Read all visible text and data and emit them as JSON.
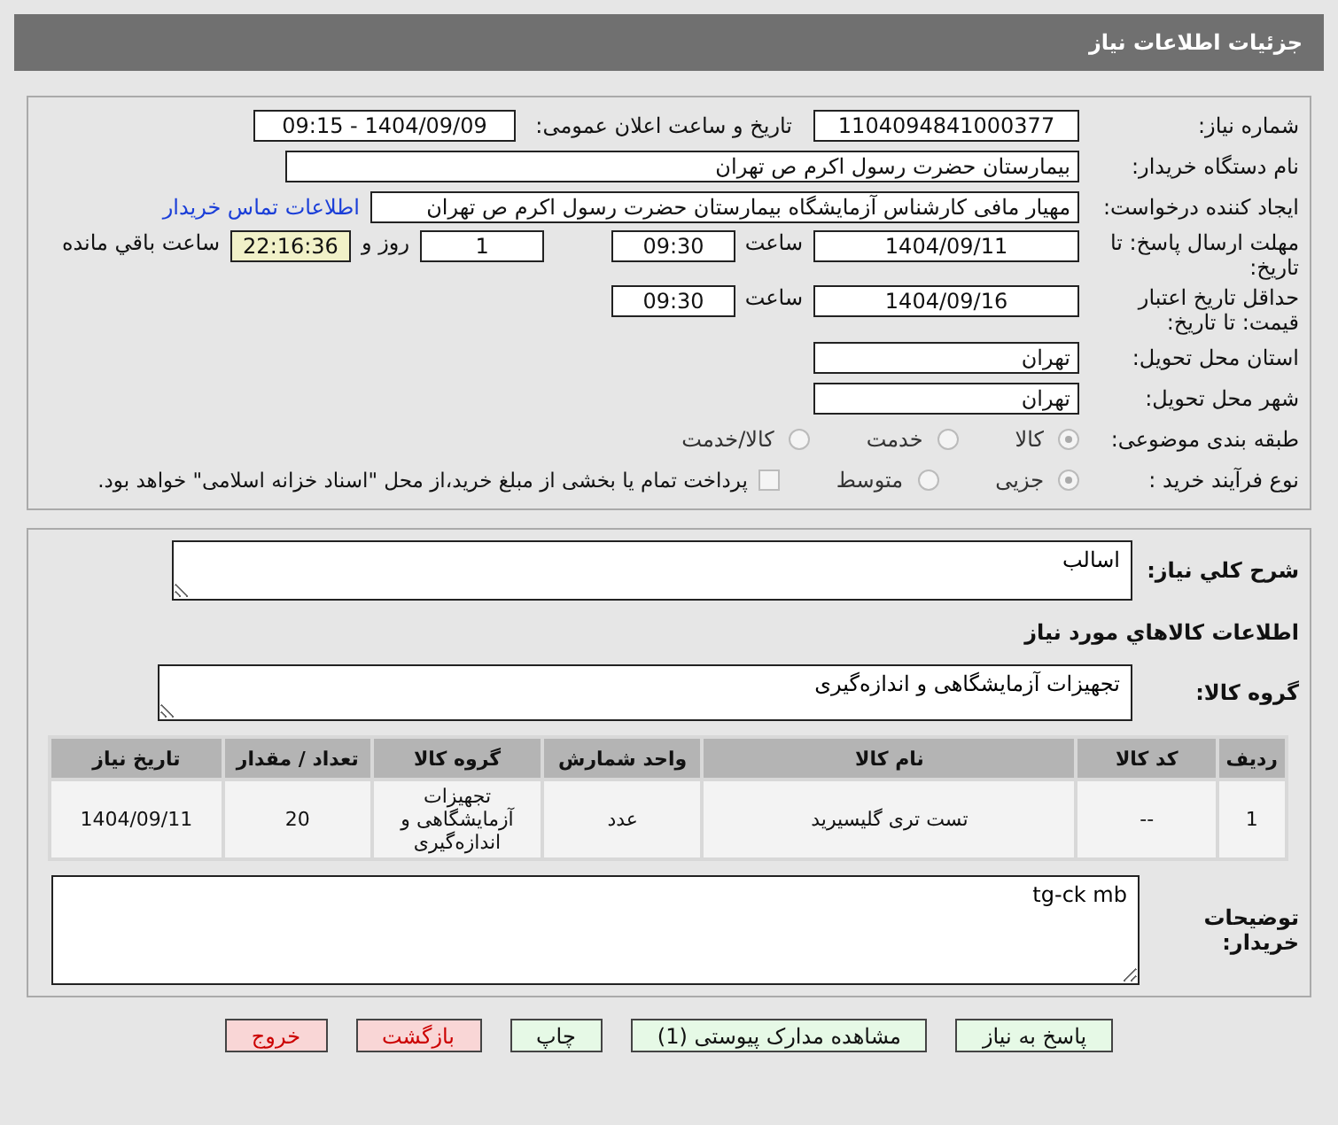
{
  "header": {
    "title": "جزئیات اطلاعات نیاز"
  },
  "need_number": {
    "label": "شماره نیاز:",
    "value": "1104094841000377"
  },
  "announce": {
    "label": "تاریخ و ساعت اعلان عمومی:",
    "value": "1404/09/09 - 09:15"
  },
  "buyer": {
    "label": "نام دستگاه خریدار:",
    "value": "بیمارستان حضرت رسول اکرم ص  تهران"
  },
  "creator": {
    "label": "ایجاد کننده درخواست:",
    "value": "مهیار مافی کارشناس آزمایشگاه بیمارستان حضرت رسول اکرم ص  تهران",
    "link": "اطلاعات تماس خریدار"
  },
  "deadline": {
    "label": "مهلت ارسال پاسخ: تا تاریخ:",
    "date": "1404/09/11",
    "time_label": "ساعت",
    "time": "09:30",
    "days": "1",
    "days_label": "روز و",
    "remaining": "22:16:36",
    "remaining_label": "ساعت باقي مانده"
  },
  "validity": {
    "label": "حداقل تاریخ اعتبار قیمت: تا تاریخ:",
    "date": "1404/09/16",
    "time_label": "ساعت",
    "time": "09:30"
  },
  "province": {
    "label": "استان محل تحویل:",
    "value": "تهران"
  },
  "city": {
    "label": "شهر محل تحویل:",
    "value": "تهران"
  },
  "category": {
    "label": "طبقه بندی موضوعی:",
    "options": [
      {
        "label": "کالا",
        "selected": true
      },
      {
        "label": "خدمت",
        "selected": false
      },
      {
        "label": "کالا/خدمت",
        "selected": false
      }
    ]
  },
  "process": {
    "label": "نوع فرآیند خرید :",
    "options": [
      {
        "label": "جزیی",
        "selected": true
      },
      {
        "label": "متوسط",
        "selected": false
      }
    ],
    "payment": {
      "label": "پرداخت تمام یا بخشی از مبلغ خرید،از محل \"اسناد خزانه اسلامی\" خواهد بود.",
      "checked": false
    }
  },
  "description": {
    "label": "شرح کلي نياز:",
    "value": "اسالب"
  },
  "goods_heading": "اطلاعات کالاهاي مورد نياز",
  "goods_group": {
    "label": "گروه کالا:",
    "value": "تجهیزات آزمایشگاهی و اندازه‌گیری"
  },
  "table": {
    "columns": [
      "ردیف",
      "کد کالا",
      "نام کالا",
      "واحد شمارش",
      "گروه کالا",
      "تعداد / مقدار",
      "تاریخ نیاز"
    ],
    "rows": [
      [
        "1",
        "--",
        "تست تری گلیسیرید",
        "عدد",
        "تجهیزات آزمایشگاهی و اندازه‌گیری",
        "20",
        "1404/09/11"
      ]
    ]
  },
  "notes": {
    "label": "توضیحات خریدار:",
    "value": "tg-ck mb"
  },
  "buttons": [
    {
      "label": "پاسخ به نیاز",
      "kind": "primary"
    },
    {
      "label": "مشاهده مدارک پیوستی (1)",
      "kind": "primary"
    },
    {
      "label": "چاپ",
      "kind": "primary"
    },
    {
      "label": "بازگشت",
      "kind": "danger"
    },
    {
      "label": "خروج",
      "kind": "danger"
    }
  ]
}
